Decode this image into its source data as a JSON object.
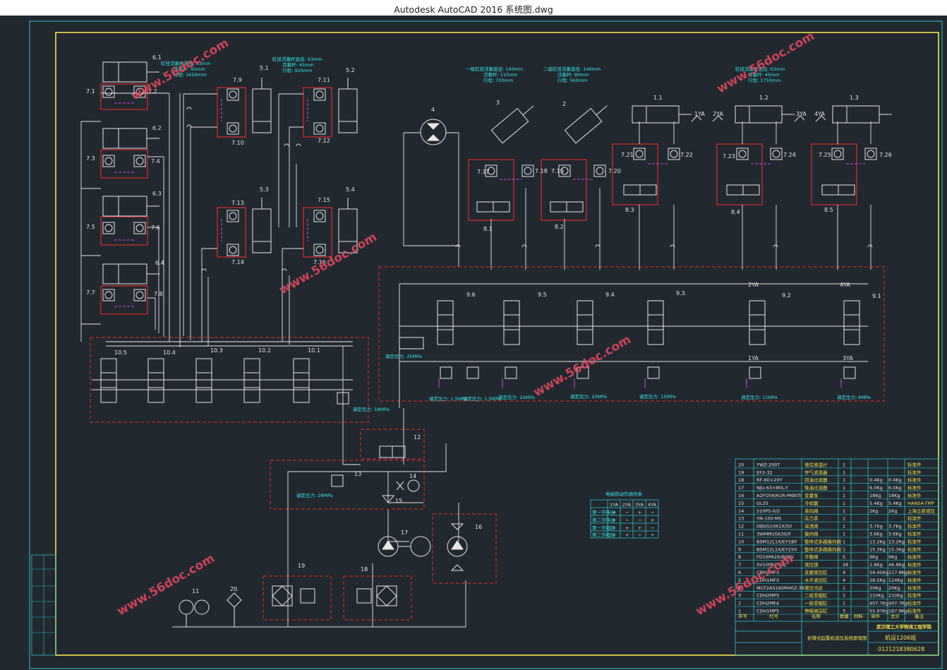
{
  "window": {
    "title": "Autodesk AutoCAD 2016     系统图.dwg"
  },
  "colors": {
    "background": "#212830",
    "frame_cyan": "#2fc4c4",
    "border_yellow": "#f2e44b",
    "dashed_red": "#e22b2b",
    "line_white": "#e6e6e6",
    "pilot_magenta": "#c84bd4",
    "watermark": "#e0485b"
  },
  "watermark": "www.56doc.com",
  "labels": {
    "cyl_left": [
      "6.1",
      "6.2",
      "6.3",
      "6.4"
    ],
    "valves_left": [
      "7.1",
      "7.2",
      "7.3",
      "7.4",
      "7.5",
      "7.6",
      "7.7",
      "7.8"
    ],
    "valves_mid": [
      "7.9",
      "7.10",
      "7.11",
      "7.12",
      "7.13",
      "7.14",
      "7.15",
      "7.16"
    ],
    "cyl_mid": [
      "5.1",
      "5.2",
      "5.3",
      "5.4"
    ],
    "motor": "4",
    "tilt_cyl": [
      "3",
      "2"
    ],
    "valves_tilt": [
      "7.17",
      "7.18",
      "7.19",
      "7.20"
    ],
    "blocks_tilt": [
      "8.1",
      "8.2"
    ],
    "right_cyl": [
      "1.1",
      "1.2",
      "1.3"
    ],
    "solenoids": [
      "1YA",
      "2YA",
      "3YA",
      "4YA"
    ],
    "valves_right": [
      "7.21",
      "7.22",
      "7.23",
      "7.24",
      "7.25",
      "7.26"
    ],
    "blocks_right": [
      "8.3",
      "8.4",
      "8.5"
    ],
    "multiway_left": [
      "10.5",
      "10.4",
      "10.3",
      "10.2",
      "10.1"
    ],
    "multiway_right": [
      "9.6",
      "9.5",
      "9.4",
      "9.3",
      "9.2",
      "9.1"
    ],
    "misc": [
      "11",
      "12",
      "13",
      "14",
      "15",
      "16",
      "17",
      "18",
      "19",
      "20"
    ]
  },
  "annotations": {
    "a1": "缸径活塞杆直径: 63mm",
    "a2": "活塞杆: 45mm",
    "a3": "行程: 1650mm",
    "a4": "缸径活塞杆直径: 63mm",
    "a5": "活塞杆: 45mm",
    "a6": "行程: 920mm",
    "a7": "一级缸径活塞直径: 180mm",
    "a8": "活塞杆: 110mm",
    "a9": "行程: 700mm",
    "a10": "二级缸径活塞直径: 140mm",
    "a11": "活塞杆: 90mm",
    "a12": "行程: 560mm",
    "a13": "缸径活塞杆直径: 63mm",
    "a14": "活塞杆: 45mm",
    "a15": "行程: 1750mm",
    "p_left": "调定压力: 18MPa",
    "p_right": "调定压力: 25MPa",
    "p12": "调定压力: 28MPa",
    "p_b1": "调定压力: 1.5MPa",
    "p_b2": "调定压力: 1.5MPa",
    "p_b3": "调定压力: 23MPa",
    "p_b4": "调定压力: 23MPa",
    "p_b5": "调定压力: 15MPa",
    "p_b6": "调定压力: 12MPa",
    "p_b7": "调定压力: 8MPa"
  },
  "solenoid_table": {
    "title": "电磁铁动作顺序表",
    "headers": [
      "",
      "1YA",
      "2YA",
      "3YA",
      "4YA"
    ],
    "rows": [
      [
        "第一节伸出",
        "+",
        "−",
        "+",
        "−"
      ],
      [
        "第二节伸出",
        "+",
        "−",
        "−",
        "+"
      ],
      [
        "第一节缩回",
        "−",
        "+",
        "+",
        "−"
      ],
      [
        "第二节缩回",
        "−",
        "+",
        "−",
        "+"
      ]
    ]
  },
  "parts_list": {
    "rows": [
      {
        "no": "20",
        "code": "YWZ-200T",
        "name": "液位液温计",
        "qty": "1",
        "w1": "",
        "w2": "",
        "remark": "标准件"
      },
      {
        "no": "19",
        "code": "EF2-32",
        "name": "空气滤清器",
        "qty": "1",
        "w1": "",
        "w2": "",
        "remark": "标准件"
      },
      {
        "no": "18",
        "code": "RF-60×20Y",
        "name": "回油过滤器",
        "qty": "1",
        "w1": "0.4Kg",
        "w2": "0.4Kg",
        "remark": "标准件"
      },
      {
        "no": "17",
        "code": "NJU-63×80L-Y",
        "name": "吸油过滤器",
        "qty": "1",
        "w1": "6.0Kg",
        "w2": "6.0Kg",
        "remark": "标准件"
      },
      {
        "no": "16",
        "code": "A2FO56/61R-PAB05",
        "name": "变量泵",
        "qty": "1",
        "w1": "18Kg",
        "w2": "18Kg",
        "remark": "标准件"
      },
      {
        "no": "15",
        "code": "GL25",
        "name": "冷却器",
        "qty": "1",
        "w1": "5.4Kg",
        "w2": "5.4Kg",
        "remark": "HANSA-TMP"
      },
      {
        "no": "14",
        "code": "S10P5-0/2",
        "name": "单向阀",
        "qty": "1",
        "w1": "2Kg",
        "w2": "2Kg",
        "remark": "上海立新液压"
      },
      {
        "no": "13",
        "code": "YN-100-M5",
        "name": "压力表",
        "qty": "1",
        "w1": "",
        "w2": "",
        "remark": "标准件"
      },
      {
        "no": "12",
        "code": "DBDS10K1X/50",
        "name": "溢流阀",
        "qty": "1",
        "w1": "3.7Kg",
        "w2": "3.7Kg",
        "remark": "标准件"
      },
      {
        "no": "11",
        "code": "3WMM10A3X/F",
        "name": "换向阀",
        "qty": "1",
        "w1": "3.6Kg",
        "w2": "3.6Kg",
        "remark": "标准件"
      },
      {
        "no": "10",
        "code": "BSM12L1X/EY180",
        "name": "整体式多路换向阀",
        "qty": "1",
        "w1": "13.2Kg",
        "w2": "13.2Kg",
        "remark": "标准件"
      },
      {
        "no": "9",
        "code": "BSM12L1X/EY250",
        "name": "整体式多路换向阀",
        "qty": "1",
        "w1": "15.3Kg",
        "w2": "15.3Kg",
        "remark": "标准件"
      },
      {
        "no": "8",
        "code": "FD16PA2X/B03V",
        "name": "平衡阀",
        "qty": "5",
        "w1": "9Kg",
        "w2": "9Kg",
        "remark": "标准件"
      },
      {
        "no": "7",
        "code": "SV10PA2-4X/",
        "name": "液压锁",
        "qty": "26",
        "w1": "1.8Kg",
        "w2": "46.8Kg",
        "remark": "标准件"
      },
      {
        "no": "6",
        "code": "CDH1MF3",
        "name": "支腿液压缸",
        "qty": "4",
        "w1": "54.45Kg",
        "w2": "217.8Kg",
        "remark": "标准件"
      },
      {
        "no": "5",
        "code": "CDH1MF3",
        "name": "水平液压缸",
        "qty": "4",
        "w1": "28.5Kg",
        "w2": "114Kg",
        "remark": "标准件"
      },
      {
        "no": "4",
        "code": "MCF2AS160M40Z-3X",
        "name": "液压马达",
        "qty": "1",
        "w1": "20Kg",
        "w2": "20Kg",
        "remark": "标准件"
      },
      {
        "no": "3",
        "code": "CDH2MP5",
        "name": "二级变幅缸",
        "qty": "1",
        "w1": "210Kg",
        "w2": "210Kg",
        "remark": "标准件"
      },
      {
        "no": "2",
        "code": "CDH2MF4",
        "name": "一级变幅缸",
        "qty": "1",
        "w1": "407.7Kg",
        "w2": "407.7Kg",
        "remark": "标准件"
      },
      {
        "no": "1",
        "code": "CDH1MP5",
        "name": "伸缩液压缸",
        "qty": "3",
        "w1": "55.97Kg",
        "w2": "167.9Kg",
        "remark": "标准件"
      }
    ],
    "header": [
      "序号",
      "代号",
      "名称",
      "数量",
      "材料",
      "单件",
      "总计",
      "备注"
    ]
  },
  "title_block": {
    "drawing_title": "折臂式起重机液压系统原理图",
    "school": "武汉理工大学物流工程学院",
    "class": "机设1206班",
    "number": "0121218380628"
  }
}
